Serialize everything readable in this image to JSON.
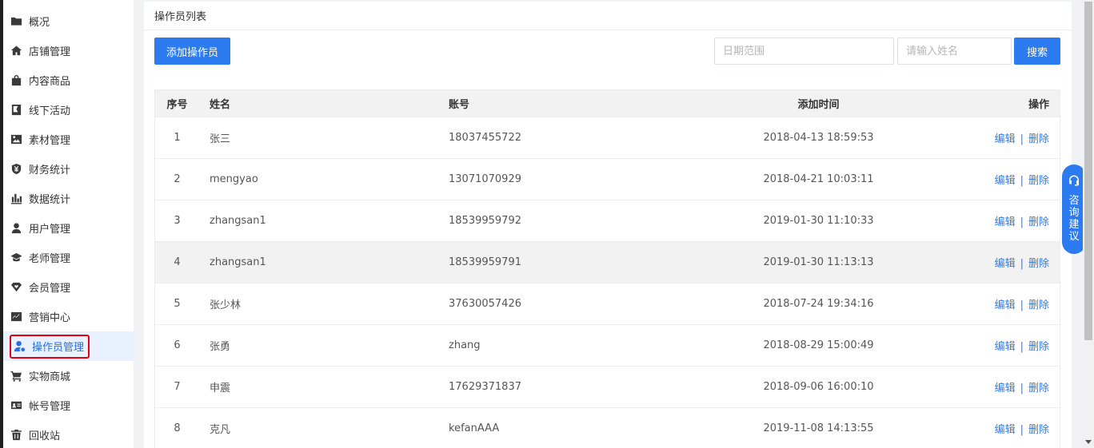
{
  "sidebar": {
    "items": [
      {
        "label": "概况",
        "icon": "folder-icon"
      },
      {
        "label": "店铺管理",
        "icon": "home-icon"
      },
      {
        "label": "内容商品",
        "icon": "bag-icon"
      },
      {
        "label": "线下活动",
        "icon": "flag-icon"
      },
      {
        "label": "素材管理",
        "icon": "image-icon"
      },
      {
        "label": "财务统计",
        "icon": "yuan-shield-icon"
      },
      {
        "label": "数据统计",
        "icon": "bar-chart-icon"
      },
      {
        "label": "用户管理",
        "icon": "user-icon"
      },
      {
        "label": "老师管理",
        "icon": "graduation-cap-icon"
      },
      {
        "label": "会员管理",
        "icon": "diamond-heart-icon"
      },
      {
        "label": "营销中心",
        "icon": "trend-chart-icon"
      },
      {
        "label": "操作员管理",
        "icon": "user-settings-icon",
        "active": true
      },
      {
        "label": "实物商城",
        "icon": "cart-icon"
      },
      {
        "label": "帐号管理",
        "icon": "id-card-icon"
      },
      {
        "label": "回收站",
        "icon": "trash-icon"
      }
    ]
  },
  "main": {
    "title": "操作员列表",
    "add_button": "添加操作员",
    "date_placeholder": "日期范围",
    "name_placeholder": "请输入姓名",
    "search_button": "搜索"
  },
  "table": {
    "headers": {
      "index": "序号",
      "name": "姓名",
      "account": "账号",
      "time": "添加时间",
      "ops": "操作"
    },
    "rows": [
      {
        "index": "1",
        "name": "张三",
        "account": "18037455722",
        "time": "2018-04-13 18:59:53"
      },
      {
        "index": "2",
        "name": "mengyao",
        "account": "13071070929",
        "time": "2018-04-21 10:03:11"
      },
      {
        "index": "3",
        "name": "zhangsan1",
        "account": "18539959792",
        "time": "2019-01-30 11:10:33"
      },
      {
        "index": "4",
        "name": "zhangsan1",
        "account": "18539959791",
        "time": "2019-01-30 11:13:13"
      },
      {
        "index": "5",
        "name": "张少林",
        "account": "37630057426",
        "time": "2018-07-24 19:34:16"
      },
      {
        "index": "6",
        "name": "张勇",
        "account": "zhang",
        "time": "2018-08-29 15:00:49"
      },
      {
        "index": "7",
        "name": "申震",
        "account": "17629371837",
        "time": "2018-09-06 16:00:10"
      },
      {
        "index": "8",
        "name": "克凡",
        "account": "kefanAAA",
        "time": "2019-11-08 14:13:55"
      }
    ],
    "edit_label": "编辑",
    "delete_label": "删除",
    "separator": "|"
  },
  "consult": {
    "label": "咨询建议",
    "icon": "headset-icon"
  },
  "colors": {
    "primary": "#2d7bf0",
    "active_bg": "#e9f1ff",
    "highlight": "#e60012"
  }
}
